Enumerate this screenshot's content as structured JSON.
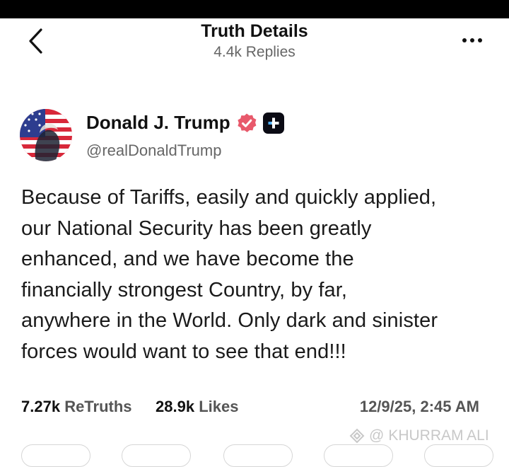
{
  "header": {
    "title": "Truth Details",
    "subtitle": "4.4k Replies"
  },
  "author": {
    "name": "Donald J. Trump",
    "handle": "@realDonaldTrump"
  },
  "post": {
    "lines": [
      "Because of Tariffs, easily and quickly applied,",
      "our National Security has been greatly",
      "enhanced, and we have become the",
      "financially strongest Country, by far,",
      "anywhere in the World. Only dark and sinister",
      "forces would want to see that end!!!"
    ]
  },
  "stats": {
    "retruths_count": "7.27k",
    "retruths_label": "ReTruths",
    "likes_count": "28.9k",
    "likes_label": "Likes",
    "timestamp": "12/9/25, 2:45 AM"
  },
  "watermark": {
    "symbol": "@",
    "text": "KHURRAM ALI"
  },
  "colors": {
    "verified": "#e8596b",
    "plus_badge": "#0b0b14",
    "header_bg": "#ffffff",
    "status_bar": "#000000"
  },
  "icons": {
    "back": "chevron-left-icon",
    "more": "more-horizontal-icon",
    "verified": "verified-badge-icon",
    "plus": "plus-badge-icon"
  }
}
